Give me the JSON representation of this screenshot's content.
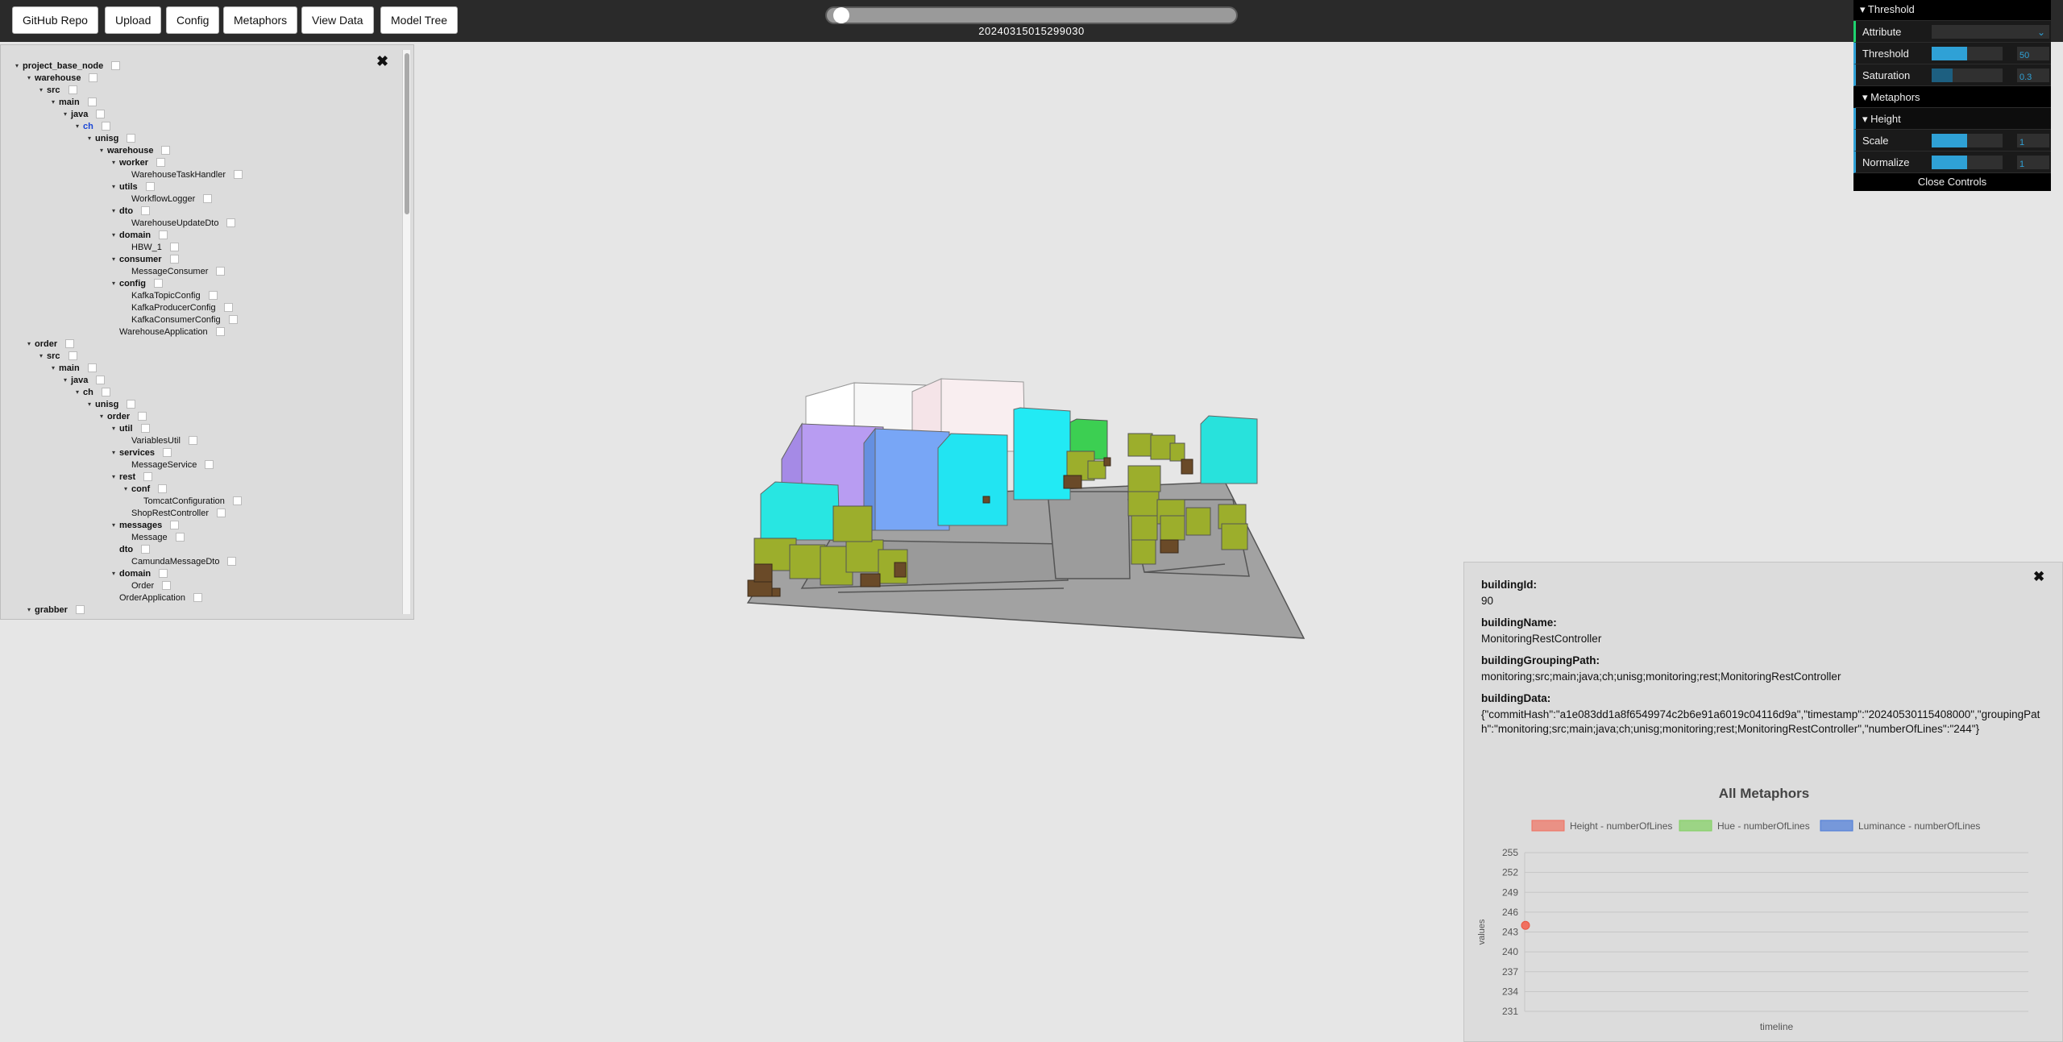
{
  "toolbar": {
    "buttons": [
      "GitHub Repo",
      "Upload",
      "Config",
      "Metaphors",
      "View Data",
      "Model Tree"
    ],
    "timestamp": "20240315015299030"
  },
  "controls": {
    "threshold_folder": "Threshold",
    "attribute_label": "Attribute",
    "threshold_label": "Threshold",
    "threshold_value": "50",
    "threshold_fill": 0.5,
    "saturation_label": "Saturation",
    "saturation_value": "0.3",
    "saturation_fill": 0.3,
    "metaphors_folder": "Metaphors",
    "height_folder": "Height",
    "scale_label": "Scale",
    "scale_value": "1",
    "normalize_label": "Normalize",
    "normalize_value": "1",
    "close_label": "Close Controls"
  },
  "tree": [
    {
      "label": "project_base_node",
      "depth": 0,
      "dir": true
    },
    {
      "label": "warehouse",
      "depth": 1,
      "dir": true
    },
    {
      "label": "src",
      "depth": 2,
      "dir": true
    },
    {
      "label": "main",
      "depth": 3,
      "dir": true
    },
    {
      "label": "java",
      "depth": 4,
      "dir": true
    },
    {
      "label": "ch",
      "depth": 5,
      "dir": true,
      "highlight": true
    },
    {
      "label": "unisg",
      "depth": 6,
      "dir": true
    },
    {
      "label": "warehouse",
      "depth": 7,
      "dir": true
    },
    {
      "label": "worker",
      "depth": 8,
      "dir": true
    },
    {
      "label": "WarehouseTaskHandler",
      "depth": 9,
      "dir": false
    },
    {
      "label": "utils",
      "depth": 8,
      "dir": true
    },
    {
      "label": "WorkflowLogger",
      "depth": 9,
      "dir": false
    },
    {
      "label": "dto",
      "depth": 8,
      "dir": true
    },
    {
      "label": "WarehouseUpdateDto",
      "depth": 9,
      "dir": false
    },
    {
      "label": "domain",
      "depth": 8,
      "dir": true
    },
    {
      "label": "HBW_1",
      "depth": 9,
      "dir": false
    },
    {
      "label": "consumer",
      "depth": 8,
      "dir": true
    },
    {
      "label": "MessageConsumer",
      "depth": 9,
      "dir": false
    },
    {
      "label": "config",
      "depth": 8,
      "dir": true
    },
    {
      "label": "KafkaTopicConfig",
      "depth": 9,
      "dir": false
    },
    {
      "label": "KafkaProducerConfig",
      "depth": 9,
      "dir": false
    },
    {
      "label": "KafkaConsumerConfig",
      "depth": 9,
      "dir": false
    },
    {
      "label": "WarehouseApplication",
      "depth": 8,
      "dir": false
    },
    {
      "label": "order",
      "depth": 1,
      "dir": true
    },
    {
      "label": "src",
      "depth": 2,
      "dir": true
    },
    {
      "label": "main",
      "depth": 3,
      "dir": true
    },
    {
      "label": "java",
      "depth": 4,
      "dir": true
    },
    {
      "label": "ch",
      "depth": 5,
      "dir": true
    },
    {
      "label": "unisg",
      "depth": 6,
      "dir": true
    },
    {
      "label": "order",
      "depth": 7,
      "dir": true
    },
    {
      "label": "util",
      "depth": 8,
      "dir": true
    },
    {
      "label": "VariablesUtil",
      "depth": 9,
      "dir": false
    },
    {
      "label": "services",
      "depth": 8,
      "dir": true
    },
    {
      "label": "MessageService",
      "depth": 9,
      "dir": false
    },
    {
      "label": "rest",
      "depth": 8,
      "dir": true
    },
    {
      "label": "conf",
      "depth": 9,
      "dir": true
    },
    {
      "label": "TomcatConfiguration",
      "depth": 10,
      "dir": false
    },
    {
      "label": "ShopRestController",
      "depth": 9,
      "dir": false
    },
    {
      "label": "messages",
      "depth": 8,
      "dir": true
    },
    {
      "label": "Message",
      "depth": 9,
      "dir": false
    },
    {
      "label": "dto",
      "depth": 8,
      "dir": true,
      "noarrow": true
    },
    {
      "label": "CamundaMessageDto",
      "depth": 9,
      "dir": false
    },
    {
      "label": "domain",
      "depth": 8,
      "dir": true
    },
    {
      "label": "Order",
      "depth": 9,
      "dir": false
    },
    {
      "label": "OrderApplication",
      "depth": 8,
      "dir": false
    },
    {
      "label": "grabber",
      "depth": 1,
      "dir": true
    }
  ],
  "info": {
    "building_id_key": "buildingId:",
    "building_id": "90",
    "building_name_key": "buildingName:",
    "building_name": "MonitoringRestController",
    "grouping_path_key": "buildingGroupingPath:",
    "grouping_path": "monitoring;src;main;java;ch;unisg;monitoring;rest;MonitoringRestController",
    "building_data_key": "buildingData:",
    "building_data": "{\"commitHash\":\"a1e083dd1a8f6549974c2b6e91a6019c04116d9a\",\"timestamp\":\"20240530115408000\",\"groupingPath\":\"monitoring;src;main;java;ch;unisg;monitoring;rest;MonitoringRestController\",\"numberOfLines\":\"244\"}"
  },
  "chart_data": {
    "type": "scatter",
    "title": "All Metaphors",
    "xlabel": "timeline",
    "ylabel": "values",
    "legend_position": "top",
    "series": [
      {
        "name": "Height - numberOfLines",
        "color": "#f07060",
        "values": [
          244
        ]
      },
      {
        "name": "Hue - numberOfLines",
        "color": "#80d060",
        "values": []
      },
      {
        "name": "Luminance - numberOfLines",
        "color": "#4a7ad8",
        "values": []
      }
    ],
    "y_ticks": [
      255,
      252,
      249,
      246,
      243,
      240,
      237,
      234,
      231
    ],
    "ylim": [
      231,
      255
    ],
    "grid": true
  }
}
